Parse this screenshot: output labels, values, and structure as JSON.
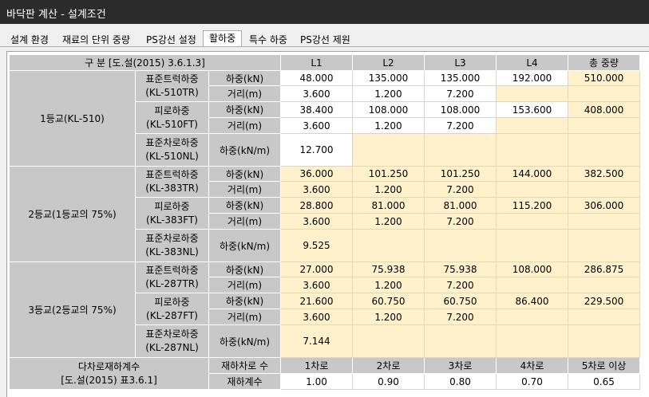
{
  "window": {
    "title": "바닥판 계산 - 설계조건"
  },
  "tabs": [
    {
      "label": "설계 환경",
      "active": false
    },
    {
      "label": "재료의 단위 중량",
      "active": false
    },
    {
      "label": "PS강선 설정",
      "active": false
    },
    {
      "label": "활하중",
      "active": true
    },
    {
      "label": "특수 하중",
      "active": false
    },
    {
      "label": "PS강선 제원",
      "active": false
    }
  ],
  "colors": {
    "header_bg": "#c8c8c8",
    "input_bg": "#ffffff",
    "calc_bg": "#fff1cc"
  },
  "table": {
    "header": {
      "category": "구 분 [도.설(2015) 3.6.1.3]",
      "columns": [
        "L1",
        "L2",
        "L3",
        "L4",
        "총 중량"
      ]
    },
    "groups": [
      {
        "name": "1등교(KL-510)",
        "truck": {
          "name": "표준트럭하중",
          "code": "(KL-510TR)",
          "load_label": "하중(kN)",
          "dist_label": "거리(m)",
          "loads": [
            "48.000",
            "135.000",
            "135.000",
            "192.000",
            "510.000"
          ],
          "dists": [
            "3.600",
            "1.200",
            "7.200"
          ]
        },
        "fatigue": {
          "name": "피로하중",
          "code": "(KL-510FT)",
          "load_label": "하중(kN)",
          "dist_label": "거리(m)",
          "loads": [
            "38.400",
            "108.000",
            "108.000",
            "153.600",
            "408.000"
          ],
          "dists": [
            "3.600",
            "1.200",
            "7.200"
          ]
        },
        "lane": {
          "name": "표준차로하중",
          "code": "(KL-510NL)",
          "load_label": "하중(kN/m)",
          "value": "12.700"
        }
      },
      {
        "name": "2등교(1등교의 75%)",
        "truck": {
          "name": "표준트럭하중",
          "code": "(KL-383TR)",
          "load_label": "하중(kN)",
          "dist_label": "거리(m)",
          "loads": [
            "36.000",
            "101.250",
            "101.250",
            "144.000",
            "382.500"
          ],
          "dists": [
            "3.600",
            "1.200",
            "7.200"
          ]
        },
        "fatigue": {
          "name": "피로하중",
          "code": "(KL-383FT)",
          "load_label": "하중(kN)",
          "dist_label": "거리(m)",
          "loads": [
            "28.800",
            "81.000",
            "81.000",
            "115.200",
            "306.000"
          ],
          "dists": [
            "3.600",
            "1.200",
            "7.200"
          ]
        },
        "lane": {
          "name": "표준차로하중",
          "code": "(KL-383NL)",
          "load_label": "하중(kN/m)",
          "value": "9.525"
        }
      },
      {
        "name": "3등교(2등교의 75%)",
        "truck": {
          "name": "표준트럭하중",
          "code": "(KL-287TR)",
          "load_label": "하중(kN)",
          "dist_label": "거리(m)",
          "loads": [
            "27.000",
            "75.938",
            "75.938",
            "108.000",
            "286.875"
          ],
          "dists": [
            "3.600",
            "1.200",
            "7.200"
          ]
        },
        "fatigue": {
          "name": "피로하중",
          "code": "(KL-287FT)",
          "load_label": "하중(kN)",
          "dist_label": "거리(m)",
          "loads": [
            "21.600",
            "60.750",
            "60.750",
            "86.400",
            "229.500"
          ],
          "dists": [
            "3.600",
            "1.200",
            "7.200"
          ]
        },
        "lane": {
          "name": "표준차로하중",
          "code": "(KL-287NL)",
          "load_label": "하중(kN/m)",
          "value": "7.144"
        }
      }
    ],
    "multilane": {
      "title": "다차로재하계수",
      "ref": "[도.설(2015) 표3.6.1]",
      "lanes_label": "재하차로 수",
      "factor_label": "재하계수",
      "lanes": [
        "1차로",
        "2차로",
        "3차로",
        "4차로",
        "5차로 이상"
      ],
      "factors": [
        "1.00",
        "0.90",
        "0.80",
        "0.70",
        "0.65"
      ]
    }
  }
}
